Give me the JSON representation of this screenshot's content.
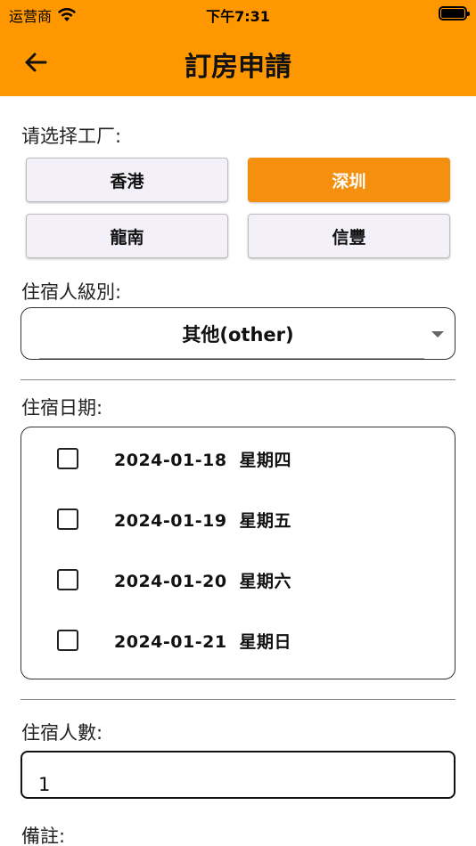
{
  "status_bar": {
    "carrier": "运营商",
    "time": "下午7:31"
  },
  "app_bar": {
    "title": "訂房申請",
    "back_icon": "arrow-left-icon"
  },
  "factory": {
    "label": "请选择工厂:",
    "options": [
      "香港",
      "深圳",
      "龍南",
      "信豐"
    ],
    "selected": "深圳"
  },
  "guest_level": {
    "label": "住宿人級別:",
    "value": "其他(other)"
  },
  "stay_dates": {
    "label": "住宿日期:",
    "items": [
      {
        "date": "2024-01-18",
        "weekday": "星期四",
        "checked": false
      },
      {
        "date": "2024-01-19",
        "weekday": "星期五",
        "checked": false
      },
      {
        "date": "2024-01-20",
        "weekday": "星期六",
        "checked": false
      },
      {
        "date": "2024-01-21",
        "weekday": "星期日",
        "checked": false
      }
    ]
  },
  "guest_count": {
    "label": "住宿人數:",
    "value": "1"
  },
  "remarks": {
    "label": "備註:"
  },
  "colors": {
    "accent": "#FF9800",
    "selected_button": "#F5900E",
    "button_bg": "#F3F0FA"
  }
}
